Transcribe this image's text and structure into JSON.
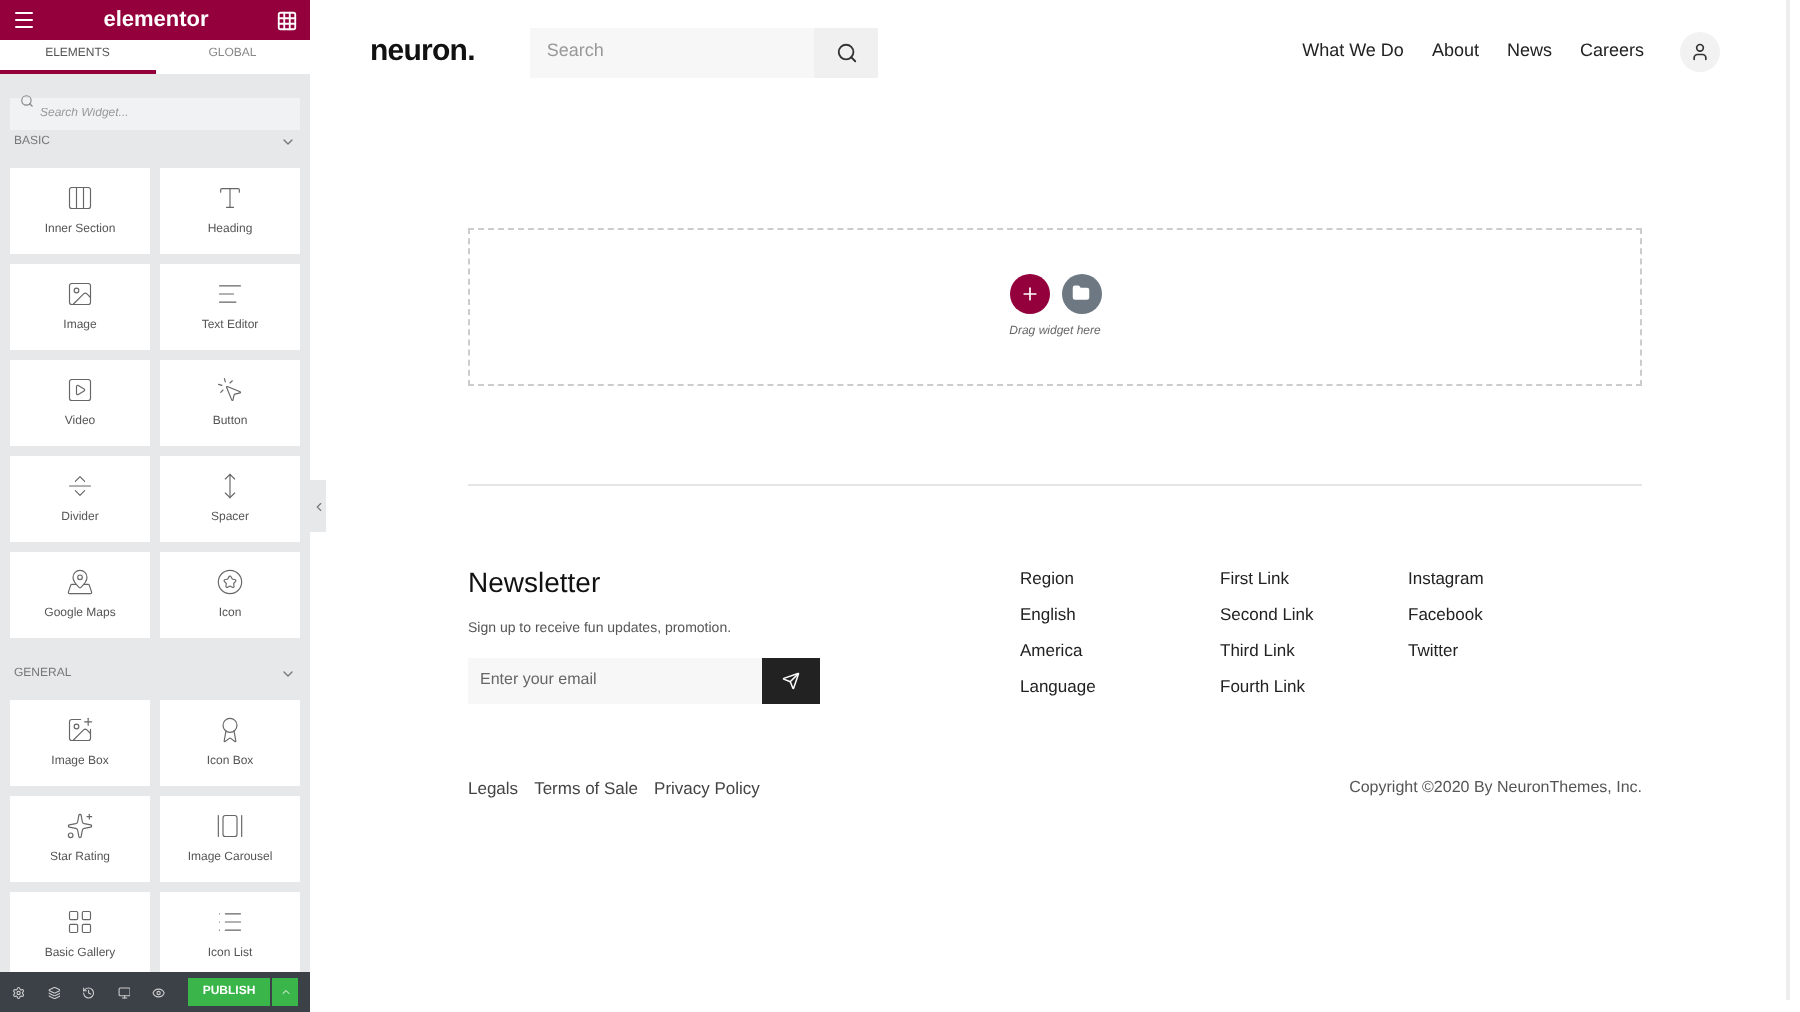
{
  "panel": {
    "title": "elementor",
    "tabs": [
      {
        "label": "ELEMENTS",
        "selected": true
      },
      {
        "label": "GLOBAL",
        "selected": false
      }
    ],
    "search": {
      "placeholder": "Search Widget..."
    },
    "categories": [
      {
        "name": "BASIC",
        "expanded": true,
        "widgets": [
          "Inner Section",
          "Heading",
          "Image",
          "Text Editor",
          "Video",
          "Button",
          "Divider",
          "Spacer",
          "Google Maps",
          "Icon"
        ]
      },
      {
        "name": "GENERAL",
        "expanded": true,
        "widgets": [
          "Image Box",
          "Icon Box",
          "Star Rating",
          "Image Carousel",
          "Basic Gallery",
          "Icon List"
        ]
      }
    ],
    "publish": "PUBLISH"
  },
  "site": {
    "logo": "neuron.",
    "search": {
      "placeholder": "Search"
    },
    "nav": [
      "What We Do",
      "About",
      "News",
      "Careers"
    ],
    "dropzone": {
      "hint": "Drag widget here"
    },
    "newsletter": {
      "title": "Newsletter",
      "text": "Sign up to receive fun updates, promotion.",
      "placeholder": "Enter your email"
    },
    "link_columns": [
      [
        "Region",
        "English",
        "America",
        "Language"
      ],
      [
        "First Link",
        "Second Link",
        "Third Link",
        "Fourth Link"
      ],
      [
        "Instagram",
        "Facebook",
        "Twitter"
      ]
    ],
    "legal_links": [
      "Legals",
      "Terms of Sale",
      "Privacy Policy"
    ],
    "copyright": "Copyright ©2020 By NeuronThemes, Inc."
  }
}
